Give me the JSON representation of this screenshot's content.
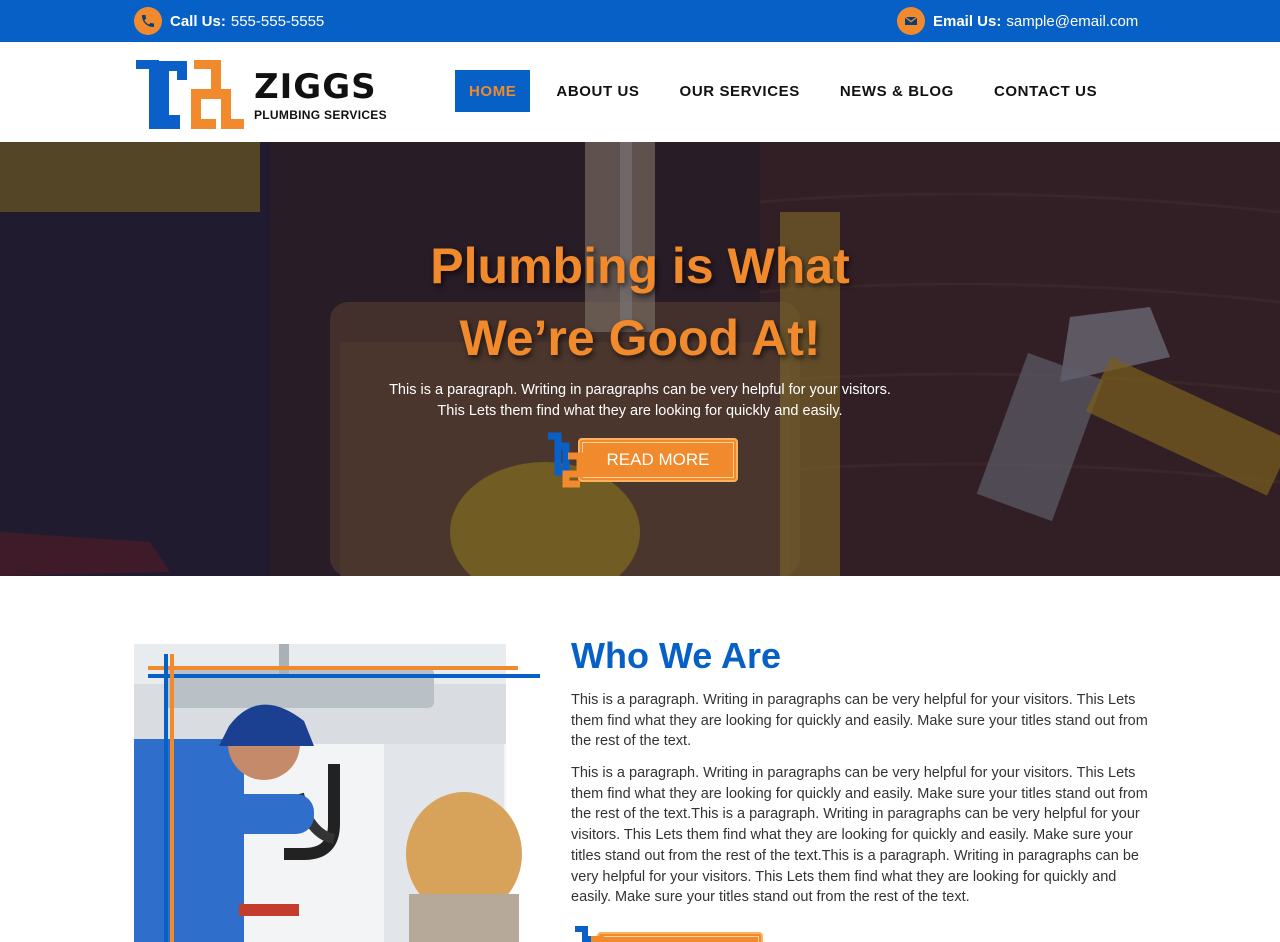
{
  "topbar": {
    "phone_label": "Call Us:",
    "phone_value": "555-555-5555",
    "email_label": "Email Us:",
    "email_value": "sample@email.com",
    "icon_phone": "phone-icon",
    "icon_email": "envelope-icon"
  },
  "brand": {
    "name": "ZIGGS",
    "tagline": "PLUMBING SERVICES"
  },
  "nav": {
    "items": [
      {
        "label": "HOME",
        "active": true
      },
      {
        "label": "ABOUT US"
      },
      {
        "label": "OUR SERVICES"
      },
      {
        "label": "NEWS & BLOG"
      },
      {
        "label": "CONTACT US"
      }
    ]
  },
  "hero": {
    "title_line1": "Plumbing is What",
    "title_line2": "We’re Good At!",
    "text_line1": "This is a paragraph. Writing in paragraphs can be very helpful for your visitors.",
    "text_line2": "This Lets them find what they are looking for quickly and easily.",
    "button_label": "READ MORE"
  },
  "about": {
    "title": "Who We Are",
    "paragraph1": "This is a paragraph. Writing in paragraphs can be very helpful for your visitors. This Lets them find what they are looking for quickly and easily. Make sure your titles stand out from the rest of the text.",
    "paragraph2": "This is a paragraph. Writing in paragraphs can be very helpful for your visitors. This Lets them find what they are looking for quickly and easily. Make sure your titles stand out from the rest of the text.This is a paragraph. Writing in paragraphs can be very helpful for your visitors. This Lets them find what they are looking for quickly and easily. Make sure your titles stand out from the rest of the text.This is a paragraph. Writing in paragraphs can be very helpful for your visitors. This Lets them find what they are looking for quickly and easily. Make sure your titles stand out from the rest of the text."
  },
  "colors": {
    "brand_blue": "#0760c5",
    "brand_orange": "#f08a2c"
  }
}
